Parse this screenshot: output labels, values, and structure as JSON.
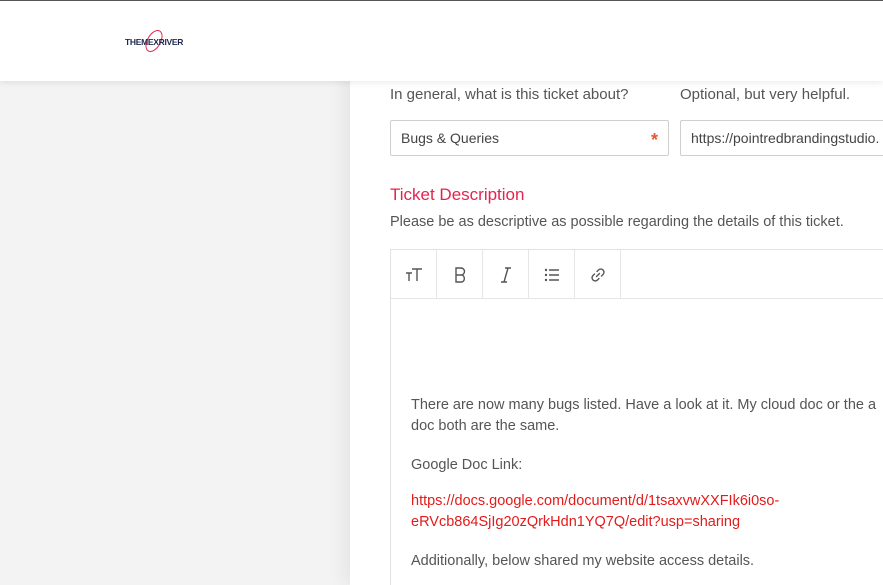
{
  "header": {
    "logo_text": "THEMEXRIVER"
  },
  "form": {
    "about_hint": "In general, what is this ticket about?",
    "optional_hint": "Optional, but very helpful.",
    "category_value": "Bugs & Queries",
    "required_mark": "*",
    "url_value": "https://pointredbrandingstudio."
  },
  "description": {
    "title": "Ticket Description",
    "subtitle": "Please be as descriptive as possible regarding the details of this ticket.",
    "paragraph_1_line_1": "There are now many bugs listed. Have a look at it. My cloud doc or the a",
    "paragraph_1_line_2": "doc both are the same.",
    "paragraph_2": "Google Doc Link:",
    "link_line_1": "https://docs.google.com/document/d/1tsaxvwXXFIk6i0so-",
    "link_line_2": "eRVcb864SjIg20zQrkHdn1YQ7Q/edit?usp=sharing",
    "paragraph_3": "Additionally, below shared my website access details."
  },
  "toolbar": {
    "icons": [
      "text-size-icon",
      "bold-icon",
      "italic-icon",
      "list-icon",
      "link-icon"
    ]
  },
  "colors": {
    "accent": "#e3244f",
    "link": "#e31b1b",
    "required": "#e05a33"
  }
}
